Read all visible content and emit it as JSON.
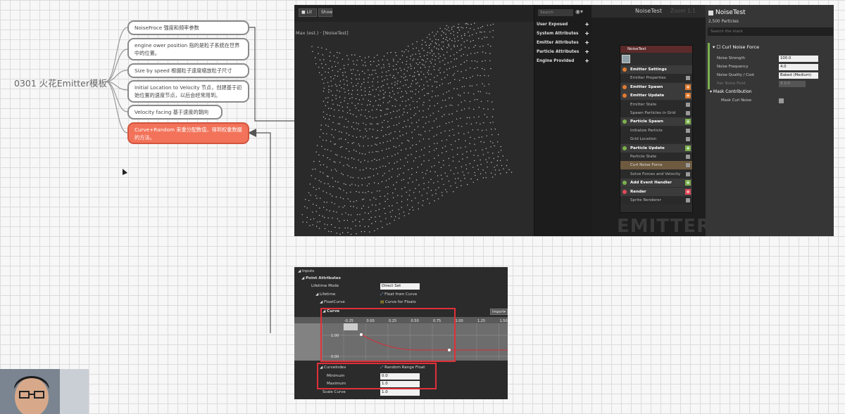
{
  "mindmap": {
    "root": "0301 火花Emitter模板",
    "nodes": [
      "NoiseFroce 强度和频率参数",
      "engine ower position 指的是粒子系统在世界中的位置。",
      "Size by speed 根据粒子速度缩放粒子尺寸",
      "Initial Location to Velocity 节点，创建基于初始位置的速度节点，以后会经常用到。",
      "Velocity facing 基于速度的朝向",
      "Curve+Random 来重分配数值，得到权重数据的方法。"
    ]
  },
  "viewport": {
    "lit_button": "Lit",
    "show_button": "Show",
    "label": "Max (est.) · [NoiseTest]"
  },
  "attributes": {
    "search_placeholder": "Search",
    "items": [
      "User Exposed",
      "System Attributes",
      "Emitter Attributes",
      "Particle Attributes",
      "Engine Provided"
    ]
  },
  "graph": {
    "title": "NoiseTest",
    "zoom": "Zoom 1:1",
    "watermark": "EMITTER",
    "node_title": "NoiseTest",
    "rows": [
      {
        "label": "Emitter Settings",
        "kind": "hd",
        "color": "#e07b30"
      },
      {
        "label": "Emitter Properties",
        "kind": "sub"
      },
      {
        "label": "Emitter Spawn",
        "kind": "hd",
        "color": "#e07b30",
        "add": "#e07b30"
      },
      {
        "label": "Emitter Update",
        "kind": "hd",
        "color": "#e07b30",
        "add": "#e07b30"
      },
      {
        "label": "Emitter State",
        "kind": "sub"
      },
      {
        "label": "Spawn Particles in Grid",
        "kind": "sub"
      },
      {
        "label": "Particle Spawn",
        "kind": "hd",
        "color": "#7bb04c",
        "add": "#7bb04c"
      },
      {
        "label": "Initialize Particle",
        "kind": "sub"
      },
      {
        "label": "Grid Location",
        "kind": "sub"
      },
      {
        "label": "Particle Update",
        "kind": "hd",
        "color": "#7bb04c",
        "add": "#7bb04c"
      },
      {
        "label": "Particle State",
        "kind": "sub"
      },
      {
        "label": "Curl Noise Force",
        "kind": "sel"
      },
      {
        "label": "Solve Forces and Velocity",
        "kind": "sub"
      },
      {
        "label": "Add Event Handler",
        "kind": "hd",
        "color": "#7bb04c",
        "add": "#7bb04c"
      },
      {
        "label": "Render",
        "kind": "hd",
        "color": "#e04a5a",
        "add": "#e04a5a"
      },
      {
        "label": "Sprite Renderer",
        "kind": "sub"
      }
    ]
  },
  "details": {
    "title": "NoiseTest",
    "count": "2,500 Particles",
    "search_placeholder": "Search the stack",
    "section": "Curl Noise Force",
    "rows": [
      {
        "label": "Noise Strength",
        "value": "100.0"
      },
      {
        "label": "Noise Frequency",
        "value": "4.0"
      },
      {
        "label": "Noise Quality / Cost",
        "value": "Baked (Medium)"
      },
      {
        "label": "Pan Noise Field",
        "value": "X 0.0"
      }
    ],
    "mask_section": "Mask Contribution",
    "mask_row": "Mask Curl Noise"
  },
  "curve_editor": {
    "inputs": "Inputs",
    "point_attributes": "Point Attributes",
    "lifetime_mode": "Lifetime Mode",
    "lifetime_mode_value": "Direct Set",
    "lifetime": "Lifetime",
    "lifetime_value": "Float from Curve",
    "float_curve": "FloatCurve",
    "float_curve_value": "Curve for Floats",
    "curve": "Curve",
    "import": "Import",
    "ticks": [
      "-0.25",
      "0.00",
      "0.25",
      "0.50",
      "0.75",
      "1.00",
      "1.25",
      "1.50"
    ],
    "y_top": "1.00",
    "y_bottom": "0.00",
    "curve_index": "CurveIndex",
    "curve_index_value": "Random Range Float",
    "minimum": "Minimum",
    "minimum_value": "0.0",
    "maximum": "Maximum",
    "maximum_value": "1.0",
    "scale_curve": "Scale Curve",
    "scale_curve_value": "1.0"
  }
}
